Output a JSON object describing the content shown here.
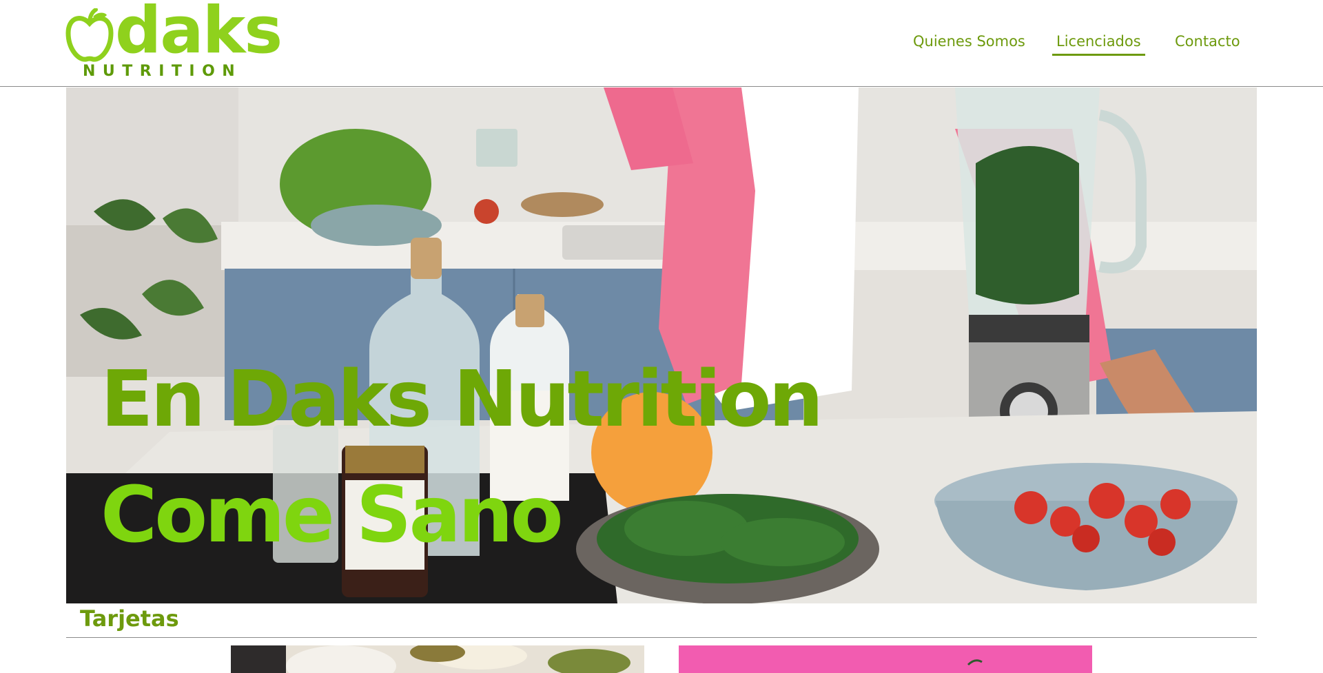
{
  "brand": {
    "name": "daks",
    "subtitle": "NUTRITION",
    "logo_icon": "apple-icon",
    "primary_color": "#8fd11d",
    "dark_color": "#6d9a0d"
  },
  "nav": {
    "items": [
      {
        "label": "Quienes Somos",
        "active": false
      },
      {
        "label": "Licenciados",
        "active": true
      },
      {
        "label": "Contacto",
        "active": false
      }
    ]
  },
  "hero": {
    "line1": "En Daks Nutrition",
    "line2": "Come Sano"
  },
  "section": {
    "title": "Tarjetas"
  }
}
